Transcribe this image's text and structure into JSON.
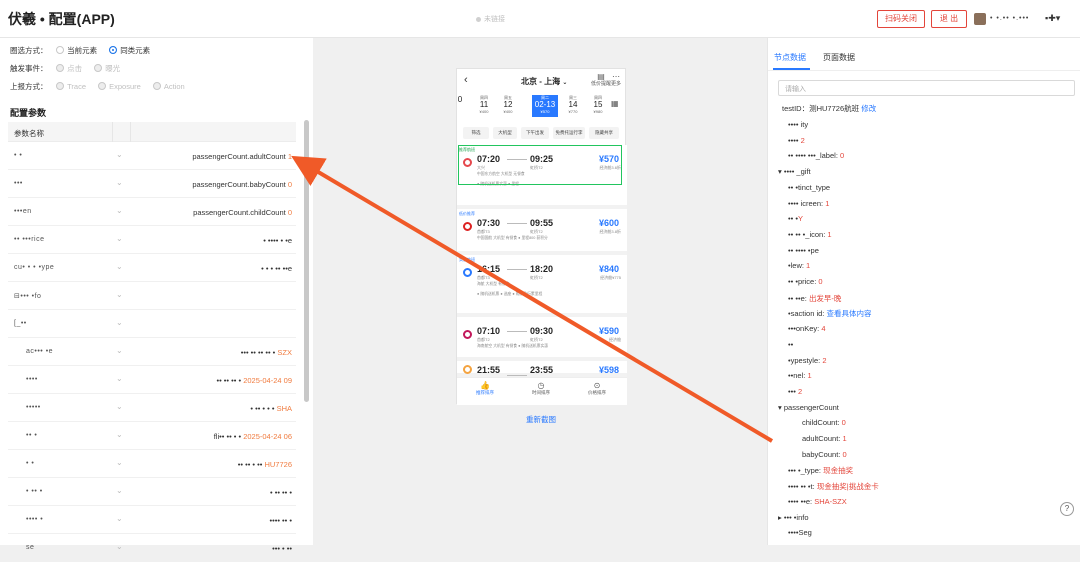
{
  "header": {
    "title": "伏羲 • 配置(APP)",
    "connection_status": "未链接",
    "scan_close": "扫码关闭",
    "logout": "退 出",
    "user_name": "• •.•• •.•••"
  },
  "left": {
    "selection_label": "圈选方式：",
    "selection_options": [
      "当前元素",
      "同类元素"
    ],
    "trigger_label": "触发事件：",
    "trigger_options": [
      "点击",
      "曝光"
    ],
    "report_label": "上报方式：",
    "report_options": [
      "Trace",
      "Exposure",
      "Action"
    ],
    "section_title": "配置参数",
    "table_header": "参数名称",
    "rows": [
      {
        "name": "• •",
        "value": "passengerCount.adultCount",
        "tail": "1"
      },
      {
        "name": "•••",
        "value": "passengerCount.babyCount",
        "tail": "0"
      },
      {
        "name": "•••en",
        "value": "passengerCount.childCount",
        "tail": "0"
      },
      {
        "name": "•• •••rice",
        "value": "• •••• • •e",
        "tail": ""
      },
      {
        "name": "cu• • • •ype",
        "value": "• • • •• ••e",
        "tail": ""
      },
      {
        "name": "⊟••• •fo",
        "value": "",
        "tail": ""
      },
      {
        "name": "[_••",
        "value": "",
        "tail": ""
      },
      {
        "name": "ac••• •e",
        "value": "••• •• •• •• •",
        "tail": "SZX"
      },
      {
        "name": "••••",
        "value": "•• •• •• •",
        "tail": "2025-04-24 09"
      },
      {
        "name": "•••••",
        "value": "• •• • • •",
        "tail": "SHA"
      },
      {
        "name": "•• •",
        "value": "fli•• •• • •",
        "tail": "2025-04-24 06"
      },
      {
        "name": "• •",
        "value": "•• •• • ••",
        "tail": "HU7726"
      },
      {
        "name": "• •• •",
        "value": "• •• •• •",
        "tail": ""
      },
      {
        "name": "•••• •",
        "value": "•••• •• •",
        "tail": ""
      },
      {
        "name": "se",
        "value": "••• • ••",
        "tail": ""
      }
    ]
  },
  "phone": {
    "route": "北京 - 上海",
    "icon_labels": [
      "低价提醒",
      "更多"
    ],
    "dates": [
      {
        "w": "",
        "d": "0",
        "p": ""
      },
      {
        "w": "周四",
        "d": "11",
        "p": "¥400"
      },
      {
        "w": "周五",
        "d": "12",
        "p": "¥400"
      },
      {
        "w": "周二",
        "d": "02-13",
        "p": "¥570"
      },
      {
        "w": "周三",
        "d": "14",
        "p": "¥770"
      },
      {
        "w": "周四",
        "d": "15",
        "p": "¥980"
      }
    ],
    "filters": [
      "筛选",
      "大机型",
      "下午出发",
      "免费托运行李",
      "隐藏共享"
    ],
    "flights": [
      {
        "tag": "推荐航班",
        "dep": "07:20",
        "arr": "09:25",
        "dep_ap": "大兴",
        "arr_ap": "虹桥T2",
        "price": "¥570",
        "note": "经济舱3.6折",
        "meta": "中国东方航空  大机型  无餐食",
        "extra": "● 随机送机票实惠 ● 里程"
      },
      {
        "tag": "低价推荐",
        "dep": "07:30",
        "arr": "09:55",
        "dep_ap": "首都T3",
        "arr_ap": "虹桥T2",
        "price": "¥600",
        "note": "经济舱3.8折",
        "meta": "中国国航  大机型  有餐食  ● 里程800 获积分",
        "extra": ""
      },
      {
        "tag": "实惠航班",
        "dep": "16:15",
        "arr": "18:20",
        "dep_ap": "首都T3",
        "arr_ap": "虹桥T2",
        "price": "¥840",
        "note": "经济舱¥775",
        "meta": "海航  大机型  有餐食",
        "extra": "● 随机送机票 ● 选座 ● 购票飞行累里程"
      },
      {
        "tag": "",
        "dep": "07:10",
        "arr": "09:30",
        "dep_ap": "首都T2",
        "arr_ap": "虹桥T2",
        "price": "¥590",
        "note": "经济舱",
        "meta": "海南航空  大机型  有餐食  ● 随机送机票实惠",
        "extra": ""
      },
      {
        "tag": "",
        "dep": "21:55",
        "arr": "23:55",
        "dep_ap": "",
        "arr_ap": "",
        "price": "¥598",
        "note": "",
        "meta": "",
        "extra": ""
      }
    ],
    "tabs": [
      "推荐排序",
      "时间排序",
      "价格排序"
    ],
    "recapture": "重新截图"
  },
  "right": {
    "tab_node": "节点数据",
    "tab_page": "页面数据",
    "search_placeholder": "请输入",
    "test_id_label": "testID：",
    "test_id_value": "测HU7726航班",
    "test_id_edit": "修改",
    "tree": [
      {
        "k": "•••• ity",
        "v": "",
        "indent": 1
      },
      {
        "k": "•••• ",
        "v": "2",
        "indent": 1
      },
      {
        "k": "•• •••• •••_label: ",
        "v": "0",
        "indent": 1
      },
      {
        "k": "▾ •••• _gift",
        "v": "",
        "indent": 0
      },
      {
        "k": "•• •tinct_type",
        "v": "",
        "indent": 1
      },
      {
        "k": "•••• icreen: ",
        "v": "1",
        "indent": 1
      },
      {
        "k": "•• •",
        "v": "Y",
        "indent": 1
      },
      {
        "k": "•• •• •_icon: ",
        "v": "1",
        "indent": 1
      },
      {
        "k": "•• •••• •pe",
        "v": "",
        "indent": 1
      },
      {
        "k": "•lew: ",
        "v": "1",
        "indent": 1
      },
      {
        "k": "•• •price: ",
        "v": "0",
        "indent": 1
      },
      {
        "k": "•• ••e: ",
        "v": "出发早-晚",
        "indent": 1
      },
      {
        "k": "•saction id: ",
        "v": "查看具体内容",
        "indent": 1,
        "link": true
      },
      {
        "k": "•••onKey: ",
        "v": "4",
        "indent": 1
      },
      {
        "k": "••",
        "v": "",
        "indent": 1
      },
      {
        "k": "•ypestyle: ",
        "v": "2",
        "indent": 1
      },
      {
        "k": "••nel: ",
        "v": "1",
        "indent": 1
      },
      {
        "k": "••• ",
        "v": "2",
        "indent": 1
      },
      {
        "k": "▾ passengerCount",
        "v": "",
        "indent": 0
      },
      {
        "k": "childCount: ",
        "v": "0",
        "indent": 2
      },
      {
        "k": "adultCount: ",
        "v": "1",
        "indent": 2
      },
      {
        "k": "babyCount: ",
        "v": "0",
        "indent": 2
      },
      {
        "k": "••• •_type: ",
        "v": "现金抽奖",
        "indent": 1
      },
      {
        "k": "•••• •• •t: ",
        "v": "现金抽奖|挑战金卡",
        "indent": 1
      },
      {
        "k": "•••• ••e: ",
        "v": "SHA-SZX",
        "indent": 1
      },
      {
        "k": "▸ ••• •info",
        "v": "",
        "indent": 0
      },
      {
        "k": "••••Seg",
        "v": "",
        "indent": 1
      }
    ]
  },
  "colors": {
    "accent": "#2979ff",
    "danger": "#e3453a",
    "highlight": "#22c55e",
    "arrow": "#f05a28"
  },
  "help_label": "?"
}
